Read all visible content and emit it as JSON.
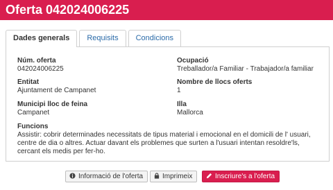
{
  "header": {
    "title": "Oferta 042024006225"
  },
  "tabs": [
    {
      "label": "Dades generals"
    },
    {
      "label": "Requisits"
    },
    {
      "label": "Condicions"
    }
  ],
  "fields": {
    "num_oferta": {
      "label": "Núm. oferta",
      "value": "042024006225"
    },
    "ocupacio": {
      "label": "Ocupació",
      "value": "Treballador/a Familiar - Trabajador/a familiar"
    },
    "entitat": {
      "label": "Entitat",
      "value": "Ajuntament de Campanet"
    },
    "nombre_llocs": {
      "label": "Nombre de llocs oferts",
      "value": "1"
    },
    "municipi": {
      "label": "Municipi lloc de feina",
      "value": "Campanet"
    },
    "illa": {
      "label": "Illa",
      "value": "Mallorca"
    },
    "funcions": {
      "label": "Funcions",
      "value": "Assistir: cobrir determinades necessitats de tipus material i emocional en el domicili de l' usuari, centre de dia o altres. Actuar davant els problemes que surten a l'usuari intentan resoldre'ls, cercant els medis per fer-ho."
    }
  },
  "actions": {
    "info_label": "Informació de l'oferta",
    "print_label": "Imprimeix",
    "apply_label": "Inscriure's a l'oferta"
  },
  "icons": {
    "info": "info-circle-icon",
    "print": "lock-icon",
    "apply": "pencil-icon"
  },
  "colors": {
    "brand": "#d91e4f",
    "link": "#2a6aa8"
  }
}
